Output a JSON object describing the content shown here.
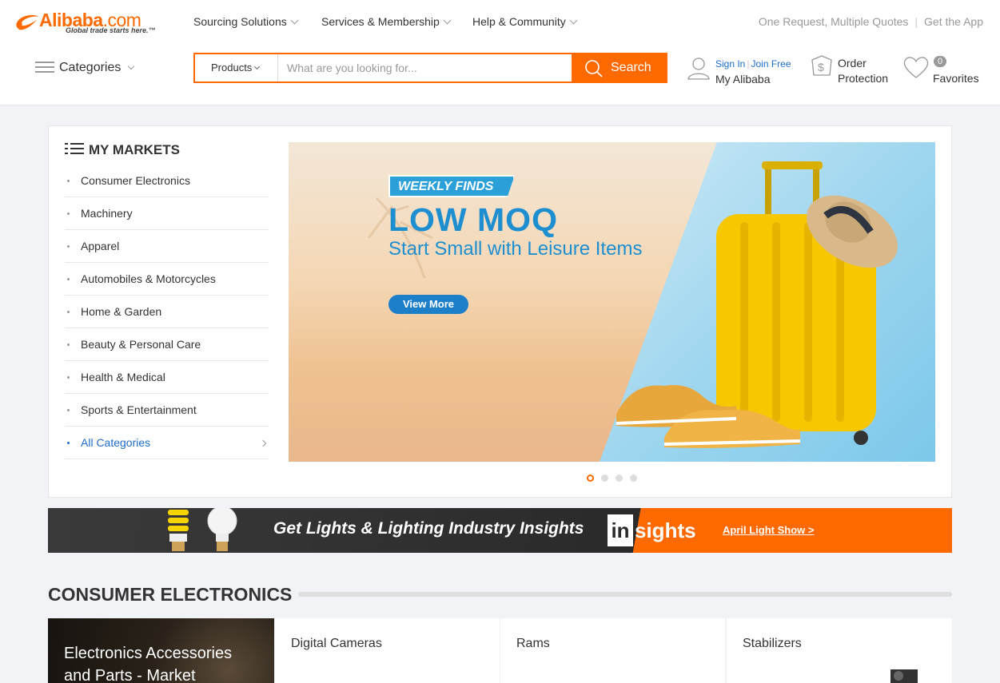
{
  "brand": {
    "name": "Alibaba",
    "suffix": ".com",
    "tagline": "Global trade starts here.",
    "trademark": "™",
    "accent": "#ff6a00",
    "link_color": "#1d6ec7"
  },
  "topnav": [
    "Sourcing Solutions",
    "Services & Membership",
    "Help & Community"
  ],
  "toplinks": [
    "One Request, Multiple Quotes",
    "Get the App"
  ],
  "categories_label": "Categories",
  "search": {
    "scope": "Products",
    "placeholder": "What are you looking for...",
    "button": "Search"
  },
  "account": {
    "sign_in": "Sign In",
    "join": "Join Free",
    "my": "My Alibaba"
  },
  "order_protection": {
    "line1": "Order",
    "line2": "Protection"
  },
  "favorites": {
    "label": "Favorites",
    "count": "0"
  },
  "markets": {
    "title": "MY MARKETS",
    "items": [
      "Consumer Electronics",
      "Machinery",
      "Apparel",
      "Automobiles & Motorcycles",
      "Home & Garden",
      "Beauty & Personal Care",
      "Health & Medical",
      "Sports & Entertainment"
    ],
    "all": "All Categories"
  },
  "banner": {
    "tag": "WEEKLY FINDS",
    "headline": "LOW MOQ",
    "sub": "Start Small with  Leisure Items",
    "cta": "View More",
    "slides": 4,
    "active_slide": 1
  },
  "lighting": {
    "text": "Get Lights & Lighting Industry Insights",
    "logo_box": "in",
    "logo_rest": "sights",
    "link": "April Light Show >"
  },
  "section": {
    "title": "CONSUMER ELECTRONICS",
    "hero_line1": "Electronics Accessories",
    "hero_line2": "and Parts - Market",
    "cards": [
      "Digital Cameras",
      "Rams",
      "Stabilizers"
    ]
  }
}
